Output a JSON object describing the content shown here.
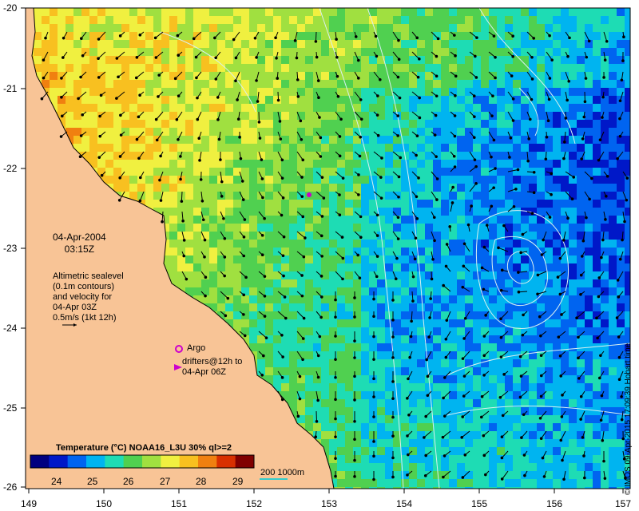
{
  "map": {
    "colors": {
      "land": "#f8c496",
      "coast": "#000000",
      "contour": "#d8f0f0",
      "arrow": "#000000",
      "argo": "#cc00cc",
      "drifter": "#cc00cc",
      "scalebar": "#33cccc"
    },
    "x_axis": {
      "ticks": [
        "149",
        "150",
        "151",
        "152",
        "153",
        "154",
        "155",
        "156",
        "157"
      ]
    },
    "y_axis": {
      "ticks": [
        "-20",
        "-21",
        "-22",
        "-23",
        "-24",
        "-25",
        "-26"
      ]
    },
    "date": {
      "line1": "04-Apr-2004",
      "line2": "03:15Z"
    },
    "altimetry": {
      "line1": "Altimetric sealevel",
      "line2": "(0.1m contours)",
      "line3": "and velocity for",
      "line4": "04-Apr 03Z",
      "line5": "0.5m/s (1kt 12h)"
    },
    "argo_label": "Argo",
    "drifters": {
      "line1": "drifters@12h to",
      "line2": "04-Apr 06Z"
    },
    "colorbar": {
      "title": "Temperature (°C) NOAA16_L3U 30% ql>=2",
      "ticks": [
        "24",
        "25",
        "26",
        "27",
        "28",
        "29"
      ],
      "colors": [
        "#000080",
        "#0018c8",
        "#0064f0",
        "#00b4f0",
        "#1edcb4",
        "#50d050",
        "#a0e040",
        "#f0f040",
        "#f8c020",
        "#f08010",
        "#d83000",
        "#800000"
      ]
    },
    "scale_label": "200  1000m",
    "credit": "© IMOS 09-Apr-2015 17:09:39 Hobart time"
  }
}
